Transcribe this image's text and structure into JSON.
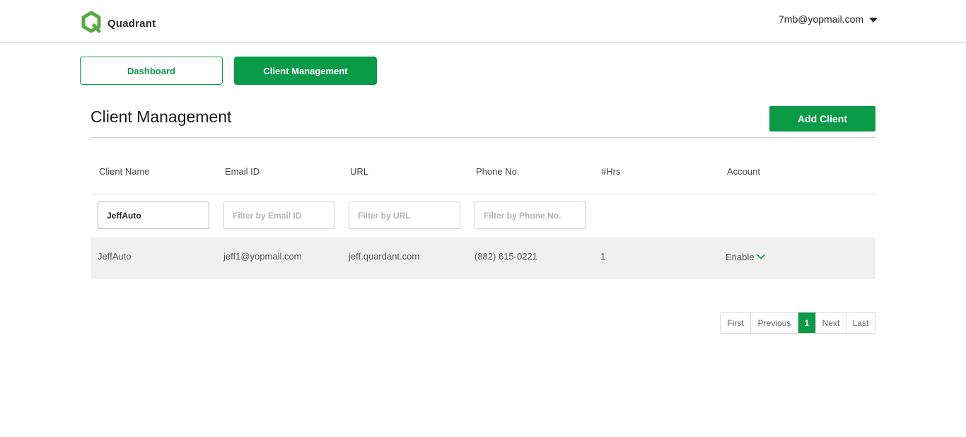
{
  "header": {
    "brand": "Quadrant",
    "user_email": "7mb@yopmail.com",
    "logo_icon": "quadrant-logo",
    "menu_icon": "caret-down-icon"
  },
  "nav": {
    "dashboard_label": "Dashboard",
    "client_management_label": "Client Management"
  },
  "page": {
    "title": "Client Management",
    "add_button_label": "Add Client"
  },
  "table": {
    "columns": [
      "Client Name",
      "Email ID",
      "URL",
      "Phone No.",
      "#Hrs",
      "Account"
    ],
    "filters": {
      "client_name_value": "JeffAuto",
      "email_placeholder": "Filter by Email ID",
      "url_placeholder": "Filter by URL",
      "phone_placeholder": "Filter by Phone No."
    },
    "rows": [
      {
        "client_name": "JeffAuto",
        "email": "jeff1@yopmail.com",
        "url": "jeff.quardant.com",
        "phone": "(882) 615-0221",
        "hrs": "1",
        "account": "Enable"
      }
    ]
  },
  "pagination": {
    "first": "First",
    "previous": "Previous",
    "current": "1",
    "next": "Next",
    "last": "Last"
  },
  "colors": {
    "accent": "#0a9a48",
    "row_background": "#f0f0f0"
  }
}
